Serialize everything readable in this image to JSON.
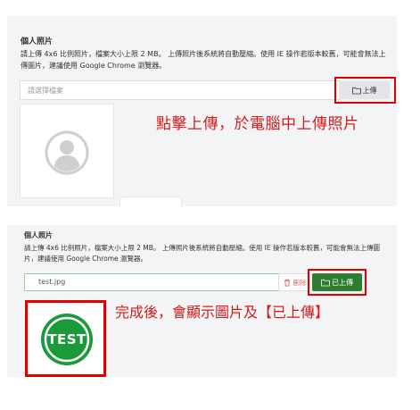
{
  "panel1": {
    "title": "個人照片",
    "description": "請上傳 4x6 比例照片，檔案大小上限 2 MB。 上傳照片後系統將自動壓縮。使用 IE 操作若版本較舊，可能會無法上傳圖片，建議使用 Google Chrome 瀏覽器。",
    "file_placeholder": "請選擇檔案",
    "upload_button_label": "上傳",
    "instruction": "點擊上傳，於電腦中上傳照片"
  },
  "panel2": {
    "title": "個人照片",
    "description": "請上傳 4x6 比例照片，檔案大小上限 2 MB。 上傳照片後系統將自動壓縮。使用 IE 操作若版本較舊，可能會無法上傳圖片，建議使用 Google Chrome 瀏覽器。",
    "file_value": "test.jpg",
    "delete_button_label": "刪除",
    "uploaded_button_label": "已上傳",
    "instruction": "完成後，會顯示圖片及【已上傳】",
    "preview_text": "TEST"
  },
  "colors": {
    "annotation_red": "#e10000",
    "success_green": "#2f7d32",
    "panel_bg": "#f3f4f6"
  },
  "icons": {
    "folder": "folder-icon",
    "trash": "trash-icon",
    "avatar": "user-avatar-icon"
  }
}
